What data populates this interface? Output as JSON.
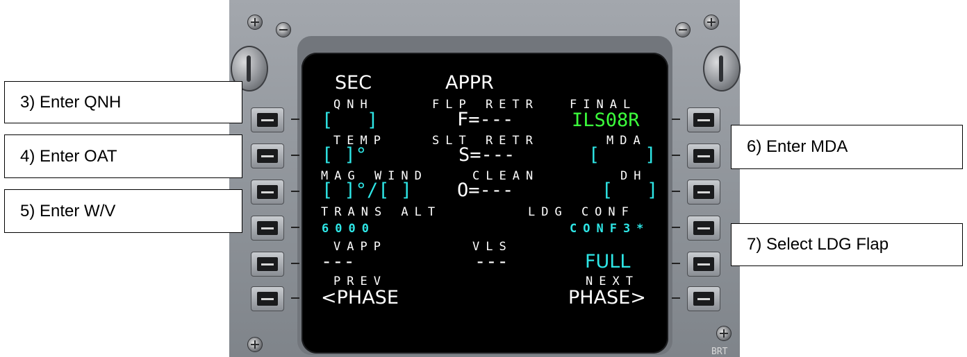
{
  "mcdu": {
    "title_left": "SEC",
    "title_right": "APPR",
    "left": [
      {
        "label": "QNH",
        "value": "[   ]"
      },
      {
        "label": "TEMP",
        "value": "[ ]°"
      },
      {
        "label": "MAG WIND",
        "value": "[ ]°/[ ]"
      },
      {
        "label": "TRANS ALT",
        "value": "6000"
      },
      {
        "label": "VAPP",
        "value": "---"
      },
      {
        "label": "PREV",
        "value": "<PHASE"
      }
    ],
    "center": [
      {
        "label": "FLP RETR",
        "value": "F=---"
      },
      {
        "label": "SLT RETR",
        "value": "S=---"
      },
      {
        "label": "CLEAN",
        "value": "O=---"
      },
      {
        "label": "VLS",
        "value": "---"
      }
    ],
    "right": [
      {
        "label": "FINAL",
        "value": "ILS08R"
      },
      {
        "label": "MDA",
        "value": "[    ]"
      },
      {
        "label": "DH",
        "value": "[   ]"
      },
      {
        "label": "LDG CONF",
        "value": "CONF3*"
      },
      {
        "value": "FULL"
      },
      {
        "label": "NEXT",
        "value": "PHASE>"
      }
    ],
    "panel_label": "BRT",
    "colors": {
      "white": "#ffffff",
      "cyan": "#2ee6e6",
      "green": "#3cff3c",
      "screen": "#000000",
      "bezel": "#8f949a"
    }
  },
  "callouts": [
    {
      "text": "3)  Enter QNH"
    },
    {
      "text": "4)  Enter OAT"
    },
    {
      "text": "5)  Enter W/V"
    },
    {
      "text": "6)  Enter MDA"
    },
    {
      "text": "7)  Select LDG Flap"
    }
  ]
}
